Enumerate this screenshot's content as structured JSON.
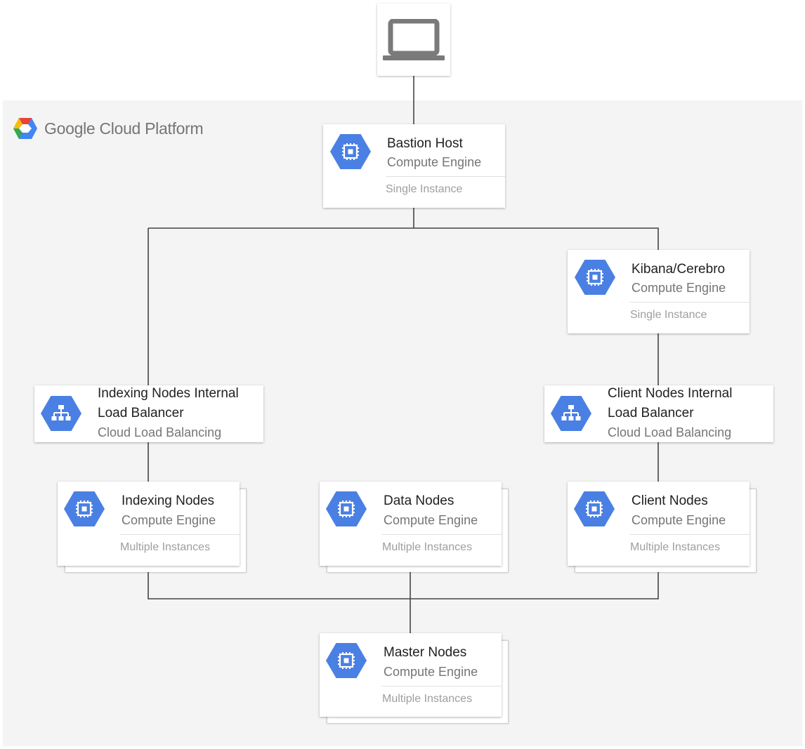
{
  "platform": {
    "name": "Google Cloud Platform",
    "logo_colors": [
      "#ea4335",
      "#fbbc05",
      "#34a853",
      "#4285f4"
    ]
  },
  "user_device": {
    "icon": "laptop-icon"
  },
  "colors": {
    "service_blue": "#4a80e3",
    "connector": "#444444"
  },
  "nodes": {
    "bastion": {
      "title": "Bastion Host",
      "subtitle": "Compute Engine",
      "note": "Single Instance",
      "icon": "compute-engine-icon"
    },
    "kibana": {
      "title": "Kibana/Cerebro",
      "subtitle": "Compute Engine",
      "note": "Single Instance",
      "icon": "compute-engine-icon"
    },
    "indexing_lb": {
      "title_line1": "Indexing Nodes Internal",
      "title_line2": "Load Balancer",
      "subtitle": "Cloud Load Balancing",
      "icon": "cloud-load-balancing-icon"
    },
    "client_lb": {
      "title_line1": "Client Nodes Internal",
      "title_line2": "Load Balancer",
      "subtitle": "Cloud Load Balancing",
      "icon": "cloud-load-balancing-icon"
    },
    "indexing_nodes": {
      "title": "Indexing Nodes",
      "subtitle": "Compute Engine",
      "note": "Multiple Instances",
      "icon": "compute-engine-icon"
    },
    "data_nodes": {
      "title": "Data Nodes",
      "subtitle": "Compute Engine",
      "note": "Multiple Instances",
      "icon": "compute-engine-icon"
    },
    "client_nodes": {
      "title": "Client Nodes",
      "subtitle": "Compute Engine",
      "note": "Multiple Instances",
      "icon": "compute-engine-icon"
    },
    "master_nodes": {
      "title": "Master Nodes",
      "subtitle": "Compute Engine",
      "note": "Multiple Instances",
      "icon": "compute-engine-icon"
    }
  }
}
